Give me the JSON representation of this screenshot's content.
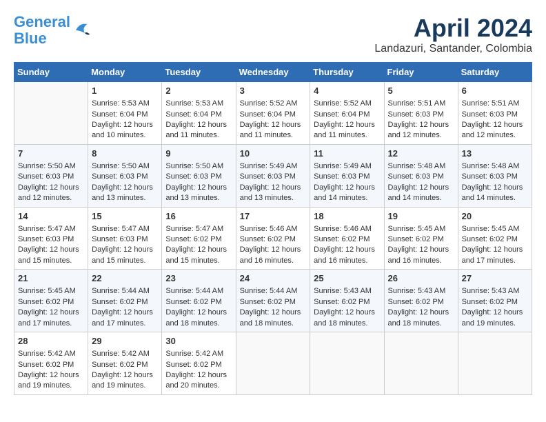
{
  "header": {
    "logo_line1": "General",
    "logo_line2": "Blue",
    "month_title": "April 2024",
    "location": "Landazuri, Santander, Colombia"
  },
  "weekdays": [
    "Sunday",
    "Monday",
    "Tuesday",
    "Wednesday",
    "Thursday",
    "Friday",
    "Saturday"
  ],
  "weeks": [
    [
      {
        "day": "",
        "sunrise": "",
        "sunset": "",
        "daylight": ""
      },
      {
        "day": "1",
        "sunrise": "Sunrise: 5:53 AM",
        "sunset": "Sunset: 6:04 PM",
        "daylight": "Daylight: 12 hours and 10 minutes."
      },
      {
        "day": "2",
        "sunrise": "Sunrise: 5:53 AM",
        "sunset": "Sunset: 6:04 PM",
        "daylight": "Daylight: 12 hours and 11 minutes."
      },
      {
        "day": "3",
        "sunrise": "Sunrise: 5:52 AM",
        "sunset": "Sunset: 6:04 PM",
        "daylight": "Daylight: 12 hours and 11 minutes."
      },
      {
        "day": "4",
        "sunrise": "Sunrise: 5:52 AM",
        "sunset": "Sunset: 6:04 PM",
        "daylight": "Daylight: 12 hours and 11 minutes."
      },
      {
        "day": "5",
        "sunrise": "Sunrise: 5:51 AM",
        "sunset": "Sunset: 6:03 PM",
        "daylight": "Daylight: 12 hours and 12 minutes."
      },
      {
        "day": "6",
        "sunrise": "Sunrise: 5:51 AM",
        "sunset": "Sunset: 6:03 PM",
        "daylight": "Daylight: 12 hours and 12 minutes."
      }
    ],
    [
      {
        "day": "7",
        "sunrise": "Sunrise: 5:50 AM",
        "sunset": "Sunset: 6:03 PM",
        "daylight": "Daylight: 12 hours and 12 minutes."
      },
      {
        "day": "8",
        "sunrise": "Sunrise: 5:50 AM",
        "sunset": "Sunset: 6:03 PM",
        "daylight": "Daylight: 12 hours and 13 minutes."
      },
      {
        "day": "9",
        "sunrise": "Sunrise: 5:50 AM",
        "sunset": "Sunset: 6:03 PM",
        "daylight": "Daylight: 12 hours and 13 minutes."
      },
      {
        "day": "10",
        "sunrise": "Sunrise: 5:49 AM",
        "sunset": "Sunset: 6:03 PM",
        "daylight": "Daylight: 12 hours and 13 minutes."
      },
      {
        "day": "11",
        "sunrise": "Sunrise: 5:49 AM",
        "sunset": "Sunset: 6:03 PM",
        "daylight": "Daylight: 12 hours and 14 minutes."
      },
      {
        "day": "12",
        "sunrise": "Sunrise: 5:48 AM",
        "sunset": "Sunset: 6:03 PM",
        "daylight": "Daylight: 12 hours and 14 minutes."
      },
      {
        "day": "13",
        "sunrise": "Sunrise: 5:48 AM",
        "sunset": "Sunset: 6:03 PM",
        "daylight": "Daylight: 12 hours and 14 minutes."
      }
    ],
    [
      {
        "day": "14",
        "sunrise": "Sunrise: 5:47 AM",
        "sunset": "Sunset: 6:03 PM",
        "daylight": "Daylight: 12 hours and 15 minutes."
      },
      {
        "day": "15",
        "sunrise": "Sunrise: 5:47 AM",
        "sunset": "Sunset: 6:03 PM",
        "daylight": "Daylight: 12 hours and 15 minutes."
      },
      {
        "day": "16",
        "sunrise": "Sunrise: 5:47 AM",
        "sunset": "Sunset: 6:02 PM",
        "daylight": "Daylight: 12 hours and 15 minutes."
      },
      {
        "day": "17",
        "sunrise": "Sunrise: 5:46 AM",
        "sunset": "Sunset: 6:02 PM",
        "daylight": "Daylight: 12 hours and 16 minutes."
      },
      {
        "day": "18",
        "sunrise": "Sunrise: 5:46 AM",
        "sunset": "Sunset: 6:02 PM",
        "daylight": "Daylight: 12 hours and 16 minutes."
      },
      {
        "day": "19",
        "sunrise": "Sunrise: 5:45 AM",
        "sunset": "Sunset: 6:02 PM",
        "daylight": "Daylight: 12 hours and 16 minutes."
      },
      {
        "day": "20",
        "sunrise": "Sunrise: 5:45 AM",
        "sunset": "Sunset: 6:02 PM",
        "daylight": "Daylight: 12 hours and 17 minutes."
      }
    ],
    [
      {
        "day": "21",
        "sunrise": "Sunrise: 5:45 AM",
        "sunset": "Sunset: 6:02 PM",
        "daylight": "Daylight: 12 hours and 17 minutes."
      },
      {
        "day": "22",
        "sunrise": "Sunrise: 5:44 AM",
        "sunset": "Sunset: 6:02 PM",
        "daylight": "Daylight: 12 hours and 17 minutes."
      },
      {
        "day": "23",
        "sunrise": "Sunrise: 5:44 AM",
        "sunset": "Sunset: 6:02 PM",
        "daylight": "Daylight: 12 hours and 18 minutes."
      },
      {
        "day": "24",
        "sunrise": "Sunrise: 5:44 AM",
        "sunset": "Sunset: 6:02 PM",
        "daylight": "Daylight: 12 hours and 18 minutes."
      },
      {
        "day": "25",
        "sunrise": "Sunrise: 5:43 AM",
        "sunset": "Sunset: 6:02 PM",
        "daylight": "Daylight: 12 hours and 18 minutes."
      },
      {
        "day": "26",
        "sunrise": "Sunrise: 5:43 AM",
        "sunset": "Sunset: 6:02 PM",
        "daylight": "Daylight: 12 hours and 18 minutes."
      },
      {
        "day": "27",
        "sunrise": "Sunrise: 5:43 AM",
        "sunset": "Sunset: 6:02 PM",
        "daylight": "Daylight: 12 hours and 19 minutes."
      }
    ],
    [
      {
        "day": "28",
        "sunrise": "Sunrise: 5:42 AM",
        "sunset": "Sunset: 6:02 PM",
        "daylight": "Daylight: 12 hours and 19 minutes."
      },
      {
        "day": "29",
        "sunrise": "Sunrise: 5:42 AM",
        "sunset": "Sunset: 6:02 PM",
        "daylight": "Daylight: 12 hours and 19 minutes."
      },
      {
        "day": "30",
        "sunrise": "Sunrise: 5:42 AM",
        "sunset": "Sunset: 6:02 PM",
        "daylight": "Daylight: 12 hours and 20 minutes."
      },
      {
        "day": "",
        "sunrise": "",
        "sunset": "",
        "daylight": ""
      },
      {
        "day": "",
        "sunrise": "",
        "sunset": "",
        "daylight": ""
      },
      {
        "day": "",
        "sunrise": "",
        "sunset": "",
        "daylight": ""
      },
      {
        "day": "",
        "sunrise": "",
        "sunset": "",
        "daylight": ""
      }
    ]
  ]
}
